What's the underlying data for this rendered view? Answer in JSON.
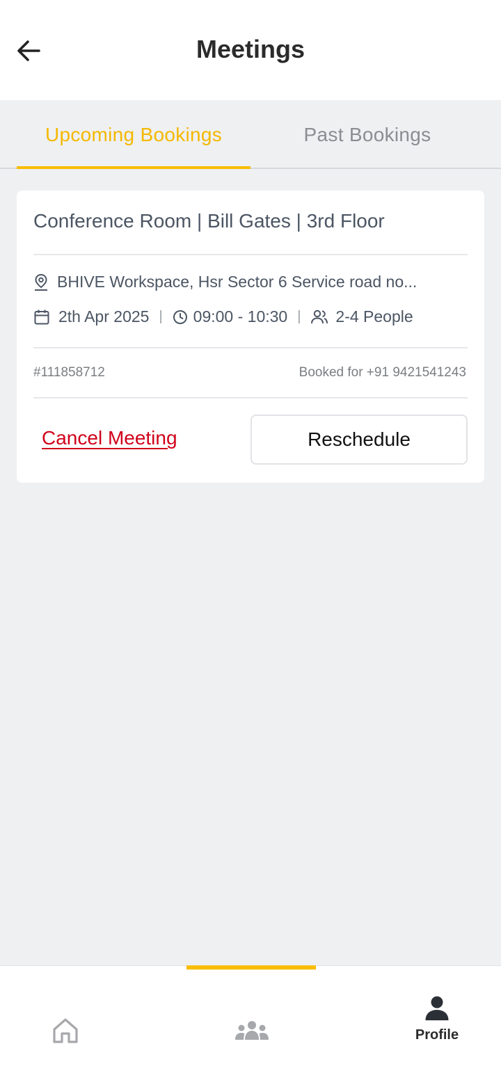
{
  "header": {
    "title": "Meetings"
  },
  "tabs": [
    {
      "label": "Upcoming Bookings",
      "active": true
    },
    {
      "label": "Past Bookings",
      "active": false
    }
  ],
  "booking": {
    "title": "Conference Room | Bill Gates | 3rd Floor",
    "location": "BHIVE Workspace, Hsr Sector 6 Service road no...",
    "date": "2th Apr 2025",
    "time": "09:00 - 10:30",
    "capacity": "2-4 People",
    "booking_id": "#111858712",
    "booked_for": "Booked for +91 9421541243",
    "cancel_label": "Cancel Meeting",
    "reschedule_label": "Reschedule"
  },
  "bottom_nav": {
    "items": [
      {
        "icon": "home-icon",
        "label": ""
      },
      {
        "icon": "community-icon",
        "label": ""
      },
      {
        "icon": "profile-icon",
        "label": "Profile"
      }
    ]
  },
  "colors": {
    "accent": "#f8bd00",
    "danger": "#d0021b"
  }
}
